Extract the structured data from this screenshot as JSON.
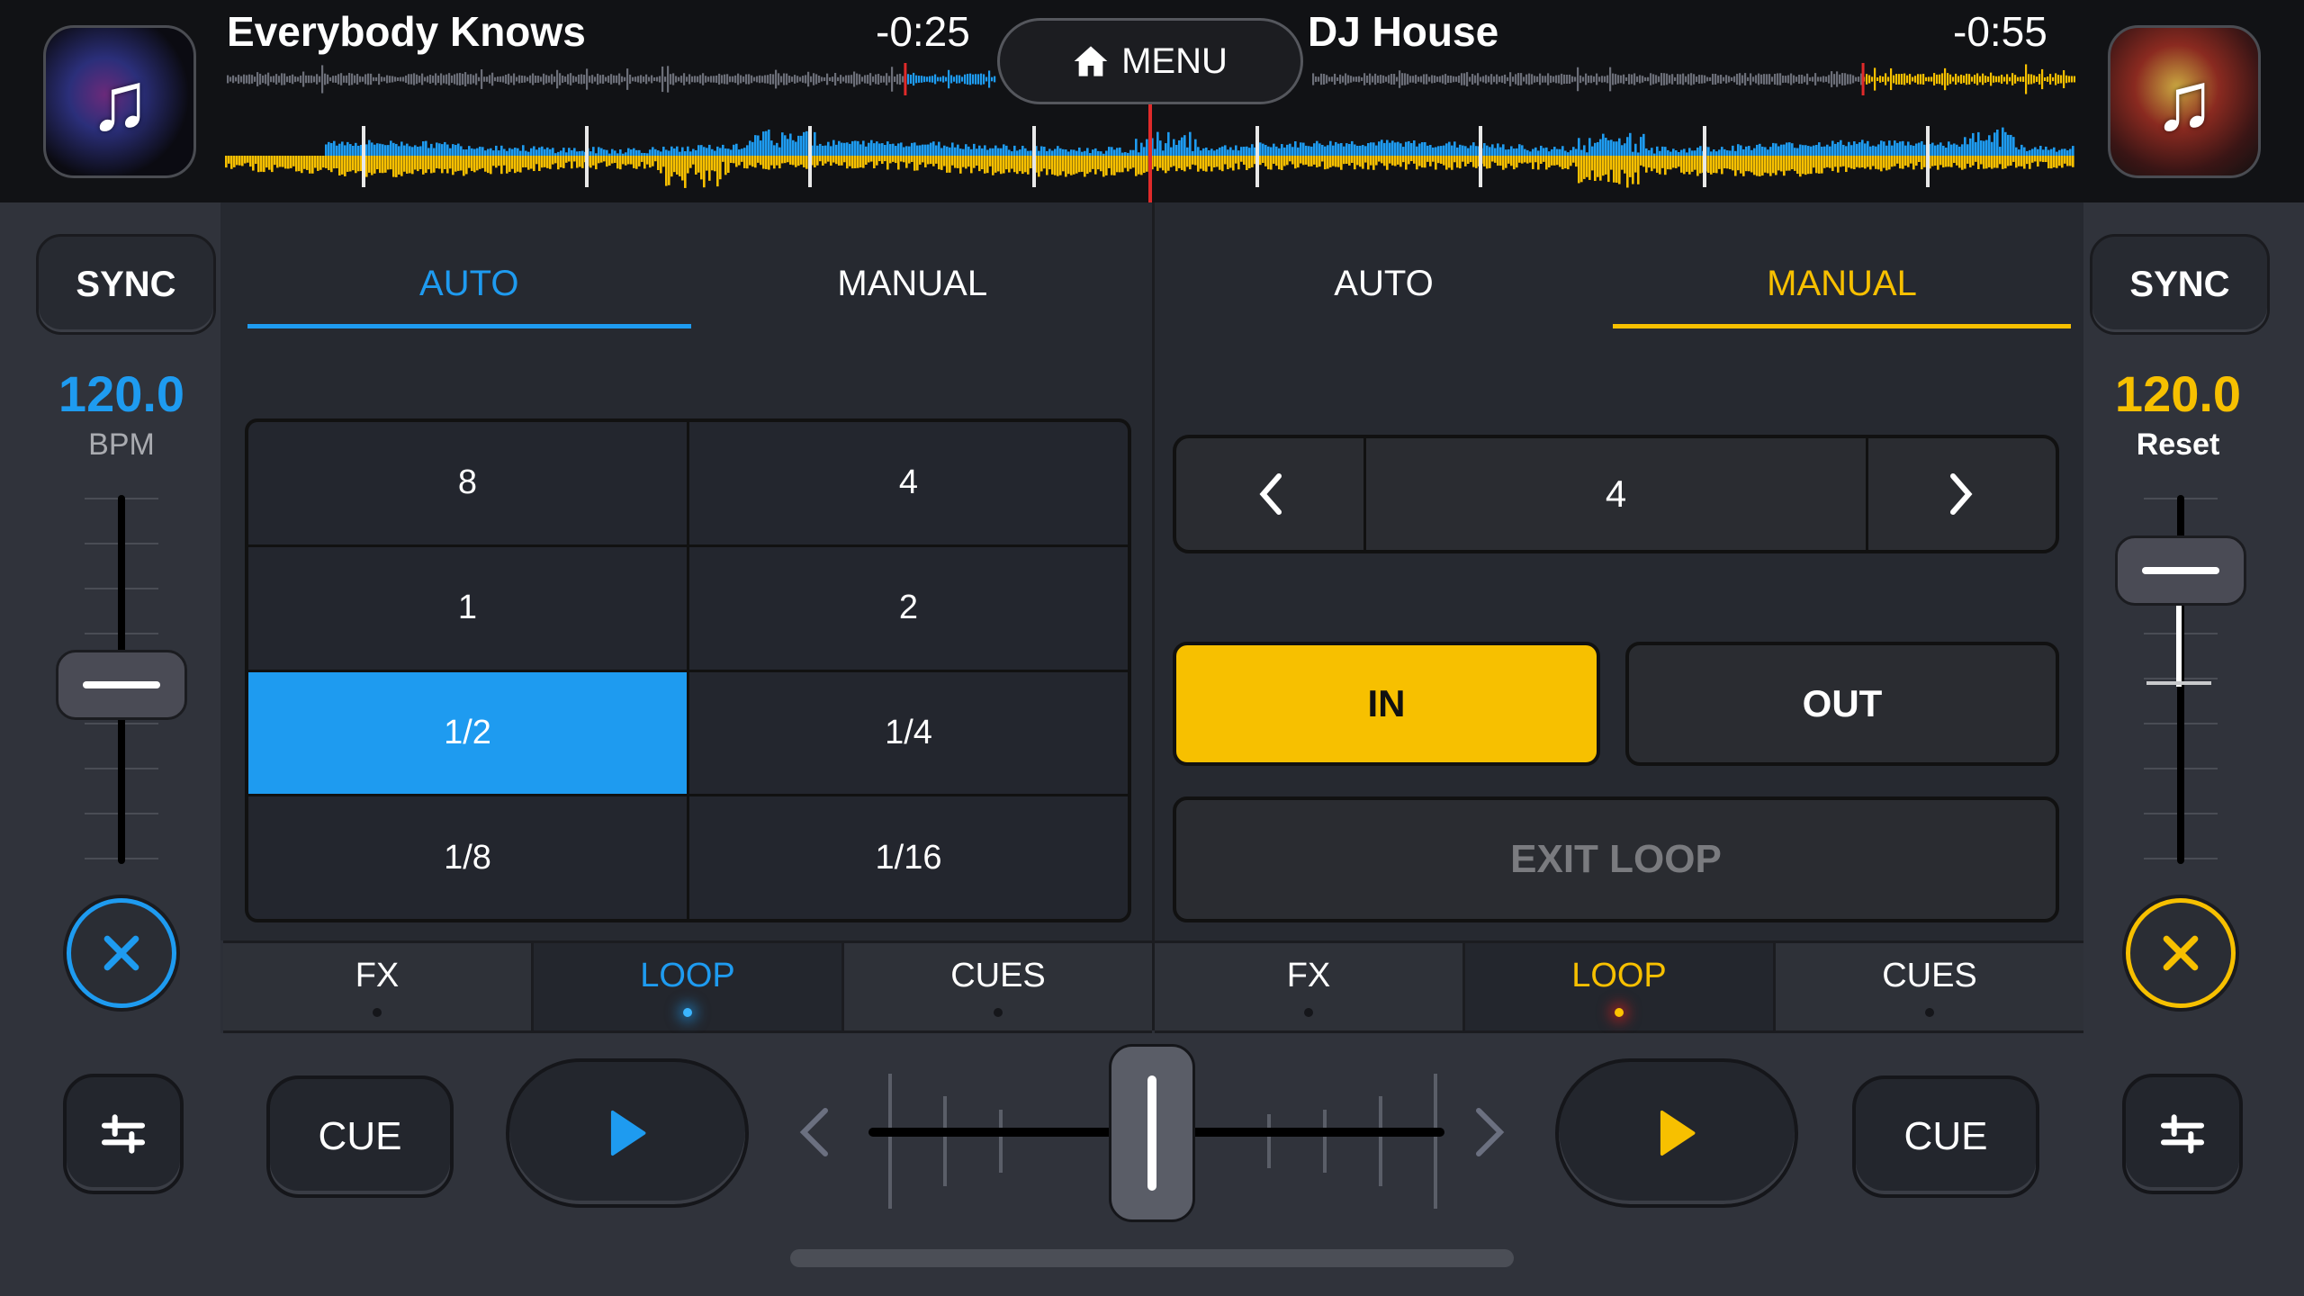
{
  "top_bar": {
    "menu_label": "MENU",
    "menu_icon": "home-icon",
    "deck_a": {
      "title": "Everybody Knows",
      "time_remaining": "-0:25",
      "artwork_icon": "music-note-icon",
      "overview_progress": 0.88
    },
    "deck_b": {
      "title": "DJ House",
      "time_remaining": "-0:55",
      "artwork_icon": "music-note-icon",
      "overview_progress": 0.72
    }
  },
  "deck_a": {
    "accent": "#1e9bf0",
    "sync_label": "SYNC",
    "bpm_value": "120.0",
    "bpm_label": "BPM",
    "pitch_position": 0.5,
    "close_icon": "close-icon",
    "mode_tabs": [
      {
        "label": "AUTO",
        "active": true
      },
      {
        "label": "MANUAL",
        "active": false
      }
    ],
    "loop_sizes": [
      "8",
      "4",
      "1",
      "2",
      "1/2",
      "1/4",
      "1/8",
      "1/16"
    ],
    "selected_loop": "1/2",
    "func_tabs": [
      {
        "label": "FX",
        "active": false
      },
      {
        "label": "LOOP",
        "active": true
      },
      {
        "label": "CUES",
        "active": false
      }
    ],
    "cue_label": "CUE",
    "play_icon": "play-icon",
    "eq_icon": "sliders-icon"
  },
  "deck_b": {
    "accent": "#f7c000",
    "sync_label": "SYNC",
    "bpm_value": "120.0",
    "bpm_label": "Reset",
    "pitch_position": 0.2,
    "close_icon": "close-icon",
    "mode_tabs": [
      {
        "label": "AUTO",
        "active": false
      },
      {
        "label": "MANUAL",
        "active": true
      }
    ],
    "loop_length": "4",
    "prev_icon": "chevron-left-icon",
    "next_icon": "chevron-right-icon",
    "in_label": "IN",
    "out_label": "OUT",
    "exit_loop_label": "EXIT LOOP",
    "func_tabs": [
      {
        "label": "FX",
        "active": false
      },
      {
        "label": "LOOP",
        "active": true
      },
      {
        "label": "CUES",
        "active": false
      }
    ],
    "cue_label": "CUE",
    "play_icon": "play-icon",
    "eq_icon": "sliders-icon"
  },
  "crossfader": {
    "position": 0.5,
    "left_arrow_icon": "chevron-left-icon",
    "right_arrow_icon": "chevron-right-icon"
  },
  "colors": {
    "blue": "#1e9bf0",
    "yellow": "#f7c000",
    "playhead": "#e02a2a",
    "waveform_gray": "#6b6e78"
  }
}
